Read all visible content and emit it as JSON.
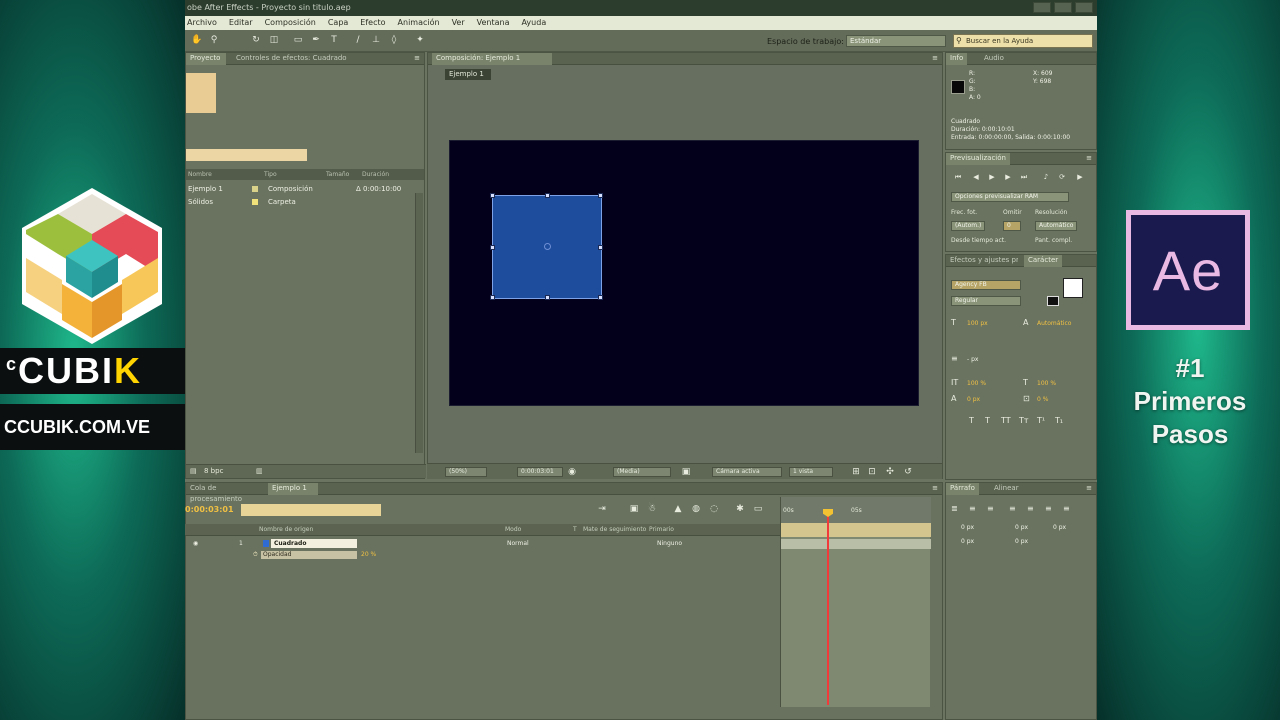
{
  "branding": {
    "name_prefix": "c",
    "name_main": "CUBI",
    "name_k": "K",
    "url": "CCUBIK.COM.VE",
    "app_logo": "Ae",
    "episode_lines": [
      "#1",
      "Primeros",
      "Pasos"
    ]
  },
  "window": {
    "title": "obe After Effects - Proyecto sin titulo.aep"
  },
  "menu": [
    "Archivo",
    "Editar",
    "Composición",
    "Capa",
    "Efecto",
    "Animación",
    "Ver",
    "Ventana",
    "Ayuda"
  ],
  "toolbar": {
    "tools": [
      "hand-icon",
      "zoom-icon",
      "rotate-icon",
      "camera-icon",
      "pan-icon",
      "rectangle-icon",
      "pen-icon",
      "type-icon",
      "brush-icon",
      "clone-icon",
      "eraser-icon",
      "puppet-icon"
    ],
    "workspace_label": "Espacio de trabajo:",
    "workspace_value": "Estándar",
    "help_search": "Buscar en la Ayuda"
  },
  "project_panel": {
    "tabs": [
      "Proyecto",
      "Controles de efectos: Cuadrado"
    ],
    "columns": [
      "Nombre",
      "Tipo",
      "Tamaño",
      "Duración"
    ],
    "items": [
      {
        "name": "Ejemplo 1",
        "type": "Composición",
        "duration": "Δ 0:00:10:00",
        "color": "#d8d28b"
      },
      {
        "name": "Sólidos",
        "type": "Carpeta",
        "duration": "",
        "color": "#f1e17a"
      }
    ],
    "bpc": "8 bpc"
  },
  "composition": {
    "tab": "Composición: Ejemplo 1",
    "crumb": "Ejemplo 1",
    "bottom": {
      "zoom": "(50%)",
      "time": "0:00:03:01",
      "resolution": "(Media)",
      "camera": "Cámara activa",
      "views": "1 vista"
    },
    "layer_color": "#1e4d9d",
    "background": "#02001b"
  },
  "info_panel": {
    "tabs": [
      "Info",
      "Audio"
    ],
    "rgba": [
      "R:",
      "G:",
      "B:",
      "A: 0"
    ],
    "xy": [
      "X: 609",
      "Y: 698"
    ],
    "layer": "Cuadrado",
    "duration": "Duración: 0:00:10:01",
    "in_out": "Entrada: 0:00:00:00, Salida: 0:00:10:00"
  },
  "preview_panel": {
    "tab": "Previsualización",
    "ram_options": "Opciones previsualizar RAM",
    "labels": [
      "Frec. fot.",
      "Omitir",
      "Resolución"
    ],
    "values": [
      "(Autom.)",
      "0",
      "Automático"
    ],
    "checks": [
      "Desde tiempo act.",
      "Pant. compl."
    ]
  },
  "character_panel": {
    "tabs": [
      "Efectos y ajustes preestablecidos",
      "Carácter"
    ],
    "font": "Agency FB",
    "style": "Regular",
    "size": "100 px",
    "leading": "Automático",
    "stroke": "- px",
    "scale_v": "100 %",
    "scale_h": "100 %",
    "baseline": "0 px",
    "tsume": "0 %"
  },
  "paragraph_panel": {
    "tabs": [
      "Párrafo",
      "Alinear"
    ],
    "values": [
      "0 px",
      "0 px",
      "0 px",
      "0 px",
      "0 px"
    ]
  },
  "timeline": {
    "tabs": [
      "Cola de procesamiento",
      "Ejemplo 1"
    ],
    "time": "0:00:03:01",
    "search": "",
    "columns": [
      "Nombre de origen",
      "Modo",
      "T",
      "Mate de seguimiento",
      "Primario"
    ],
    "layer": {
      "index": "1",
      "name": "Cuadrado",
      "mode": "Normal",
      "parent": "Ninguno"
    },
    "property": {
      "name": "Opacidad",
      "value": "20 %"
    },
    "ruler": [
      "00s",
      "05s"
    ]
  }
}
